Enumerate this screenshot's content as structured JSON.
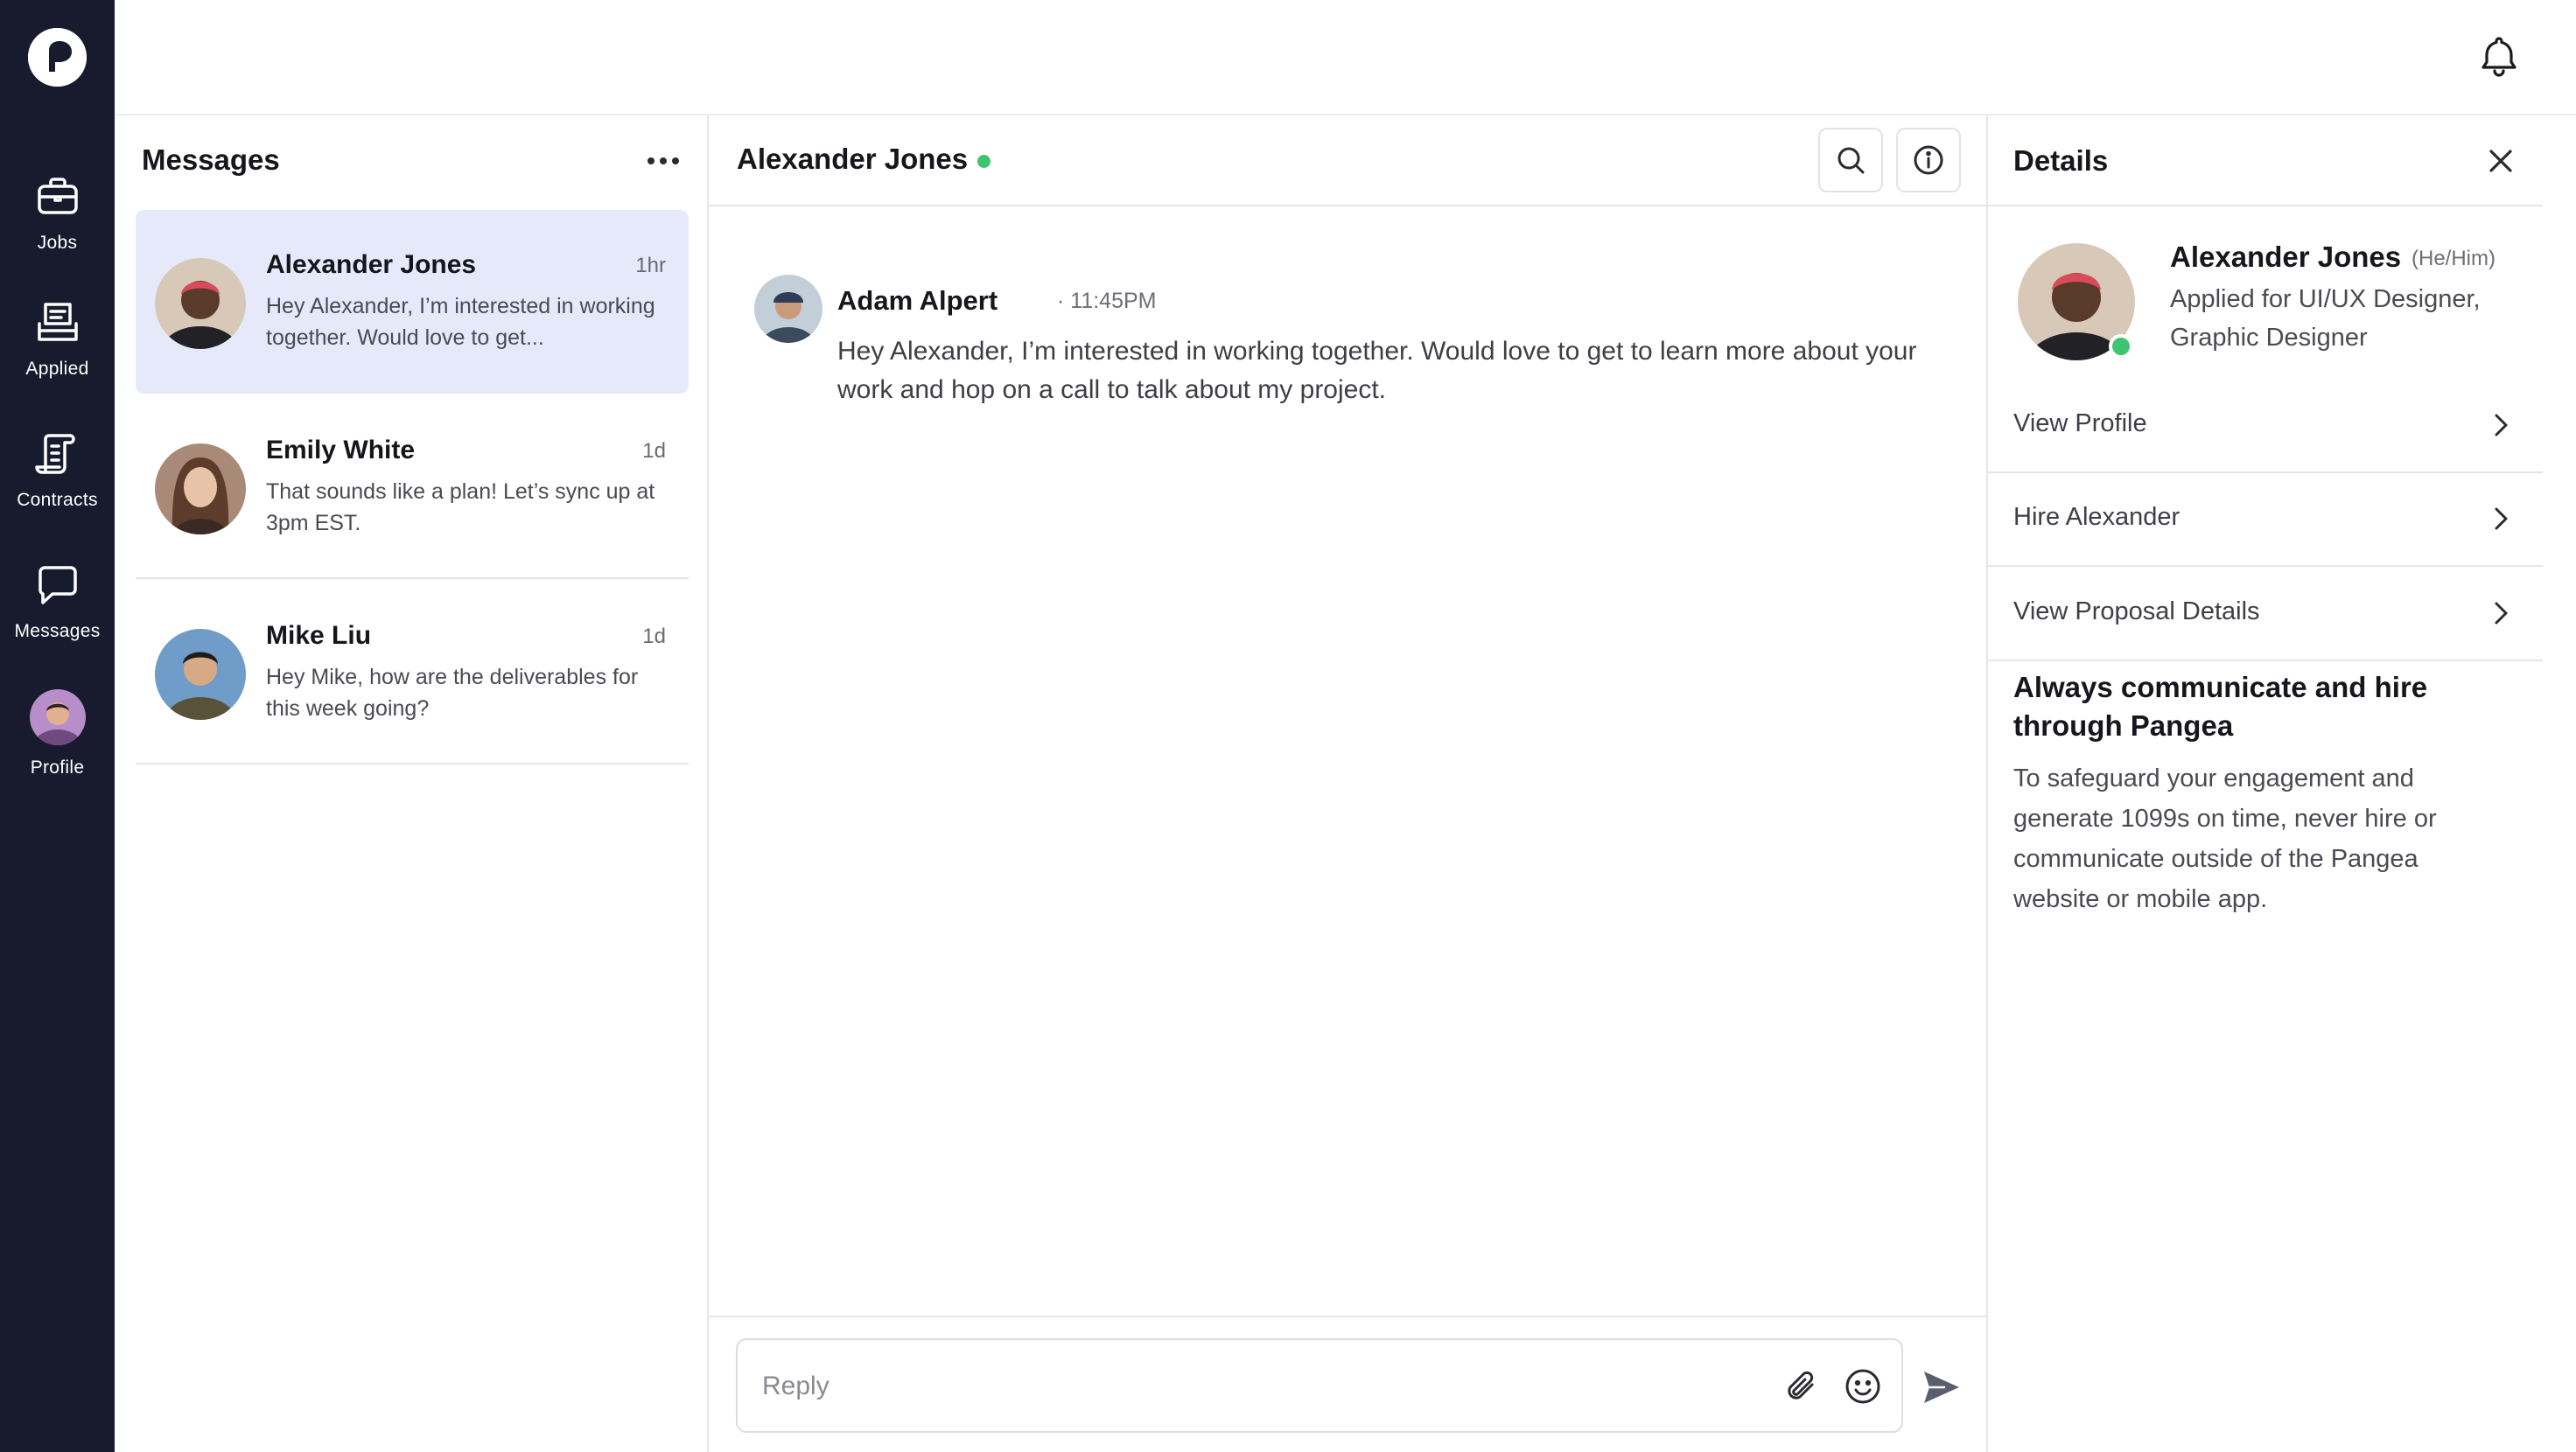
{
  "nav": {
    "brand_icon": "pangea-logo",
    "items": [
      {
        "label": "Jobs",
        "icon": "briefcase-icon"
      },
      {
        "label": "Applied",
        "icon": "document-stack-icon"
      },
      {
        "label": "Contracts",
        "icon": "contract-icon"
      },
      {
        "label": "Messages",
        "icon": "chat-bubble-icon"
      },
      {
        "label": "Profile",
        "icon": "avatar"
      }
    ]
  },
  "topbar": {
    "bell_icon": "bell-icon"
  },
  "messages_list": {
    "title": "Messages",
    "conversations": [
      {
        "name": "Alexander Jones",
        "time": "1hr",
        "preview": "Hey Alexander, I’m interested in working together. Would love to get...",
        "selected": true
      },
      {
        "name": "Emily White",
        "time": "1d",
        "preview": "That sounds like a plan! Let’s sync up at 3pm EST.",
        "selected": false
      },
      {
        "name": "Mike Liu",
        "time": "1d",
        "preview": "Hey Mike, how are the deliverables for this week going?",
        "selected": false
      }
    ]
  },
  "chat": {
    "contact_name": "Alexander Jones",
    "online": true,
    "messages": [
      {
        "sender": "Adam Alpert",
        "time": "· 11:45PM",
        "text": "Hey Alexander, I’m interested in working together. Would love to get to learn more about your work and hop on a call to talk about my project."
      }
    ],
    "reply_placeholder": "Reply"
  },
  "details": {
    "title": "Details",
    "profile": {
      "name": "Alexander Jones",
      "pronouns": "(He/Him)",
      "applied_for": "Applied for UI/UX Designer, Graphic Designer"
    },
    "actions": [
      {
        "label": "View Profile"
      },
      {
        "label": "Hire Alexander"
      },
      {
        "label": "View Proposal Details"
      }
    ],
    "notice": {
      "title": "Always communicate and hire through Pangea",
      "body": "To safeguard your engagement and generate 1099s on time, never hire or communicate outside of the Pangea website or mobile app."
    }
  },
  "colors": {
    "rail_bg": "#171b2d",
    "selected_conversation_bg": "#e5e9fa",
    "online_green": "#3ec46d"
  }
}
